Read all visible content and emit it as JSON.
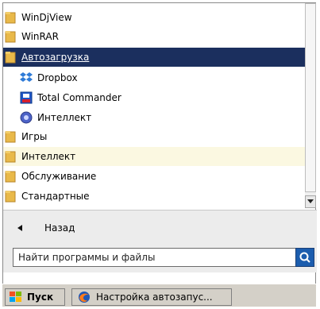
{
  "programs": {
    "items": [
      {
        "label": "WinDjView",
        "icon": "folder-icon"
      },
      {
        "label": "WinRAR",
        "icon": "folder-icon"
      },
      {
        "label": "Автозагрузка",
        "icon": "folder-icon",
        "selected": true
      },
      {
        "label": "Dropbox",
        "icon": "dropbox-icon"
      },
      {
        "label": "Total Commander",
        "icon": "total-commander-icon"
      },
      {
        "label": "Интеллект",
        "icon": "intellect-app-icon"
      },
      {
        "label": "Игры",
        "icon": "folder-icon"
      },
      {
        "label": "Интеллект",
        "icon": "folder-icon",
        "highlighted": true
      },
      {
        "label": "Обслуживание",
        "icon": "folder-icon"
      },
      {
        "label": "Стандартные",
        "icon": "folder-icon"
      }
    ]
  },
  "back": {
    "label": "Назад"
  },
  "search": {
    "placeholder": "Найти программы и файлы"
  },
  "taskbar": {
    "start_label": "Пуск",
    "task_label": "Настройка автозапус..."
  },
  "colors": {
    "selected_bg": "#1b2f5e",
    "highlight_bg": "#fbf8e1",
    "folder": "#e9b949",
    "search_button": "#1c5dae"
  }
}
